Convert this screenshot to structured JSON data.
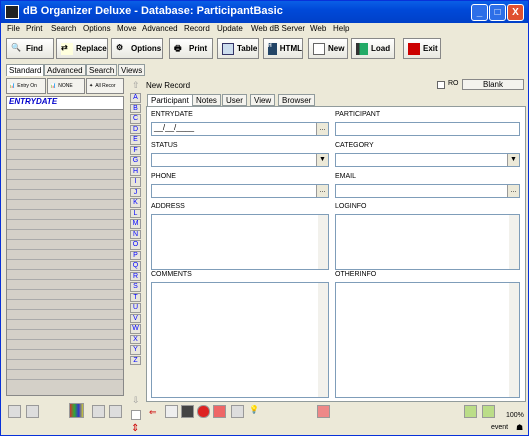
{
  "window": {
    "title": "dB Organizer Deluxe - Database: ParticipantBasic",
    "minimize": "_",
    "maximize": "□",
    "close": "X"
  },
  "menu": [
    "File",
    "Print",
    "Search",
    "Options",
    "Move",
    "Advanced",
    "Record",
    "Update",
    "Web dB Server",
    "Web",
    "Help"
  ],
  "toolbar": {
    "find": "Find",
    "replace": "Replace",
    "options": "Options",
    "print": "Print",
    "table": "Table",
    "html": "HTML",
    "new": "New",
    "load": "Load",
    "exit": "Exit"
  },
  "view_tabs": [
    "Standard",
    "Advanced",
    "Search",
    "Views"
  ],
  "left": {
    "btn_entry": "Entry On",
    "btn_none": "NONE",
    "btn_all": "All Recor",
    "list_header": "ENTRYDATE"
  },
  "letters": [
    "A",
    "B",
    "C",
    "D",
    "E",
    "F",
    "G",
    "H",
    "I",
    "J",
    "K",
    "L",
    "M",
    "N",
    "O",
    "P",
    "Q",
    "R",
    "S",
    "T",
    "U",
    "V",
    "W",
    "X",
    "Y",
    "Z"
  ],
  "record": {
    "label": "New Record",
    "ro": "RO",
    "blank": "Blank"
  },
  "form_tabs": [
    "Participant",
    "Notes",
    "User",
    "View",
    "Browser"
  ],
  "fields": {
    "entrydate_label": "ENTRYDATE",
    "entrydate_value": "__/__/____",
    "participant_label": "PARTICIPANT",
    "status_label": "STATUS",
    "category_label": "CATEGORY",
    "phone_label": "PHONE",
    "email_label": "EMAIL",
    "address_label": "ADDRESS",
    "loginfo_label": "LOGINFO",
    "comments_label": "COMMENTS",
    "otherinfo_label": "OTHERINFO"
  },
  "status": {
    "zoom": "100%",
    "event": "event"
  }
}
